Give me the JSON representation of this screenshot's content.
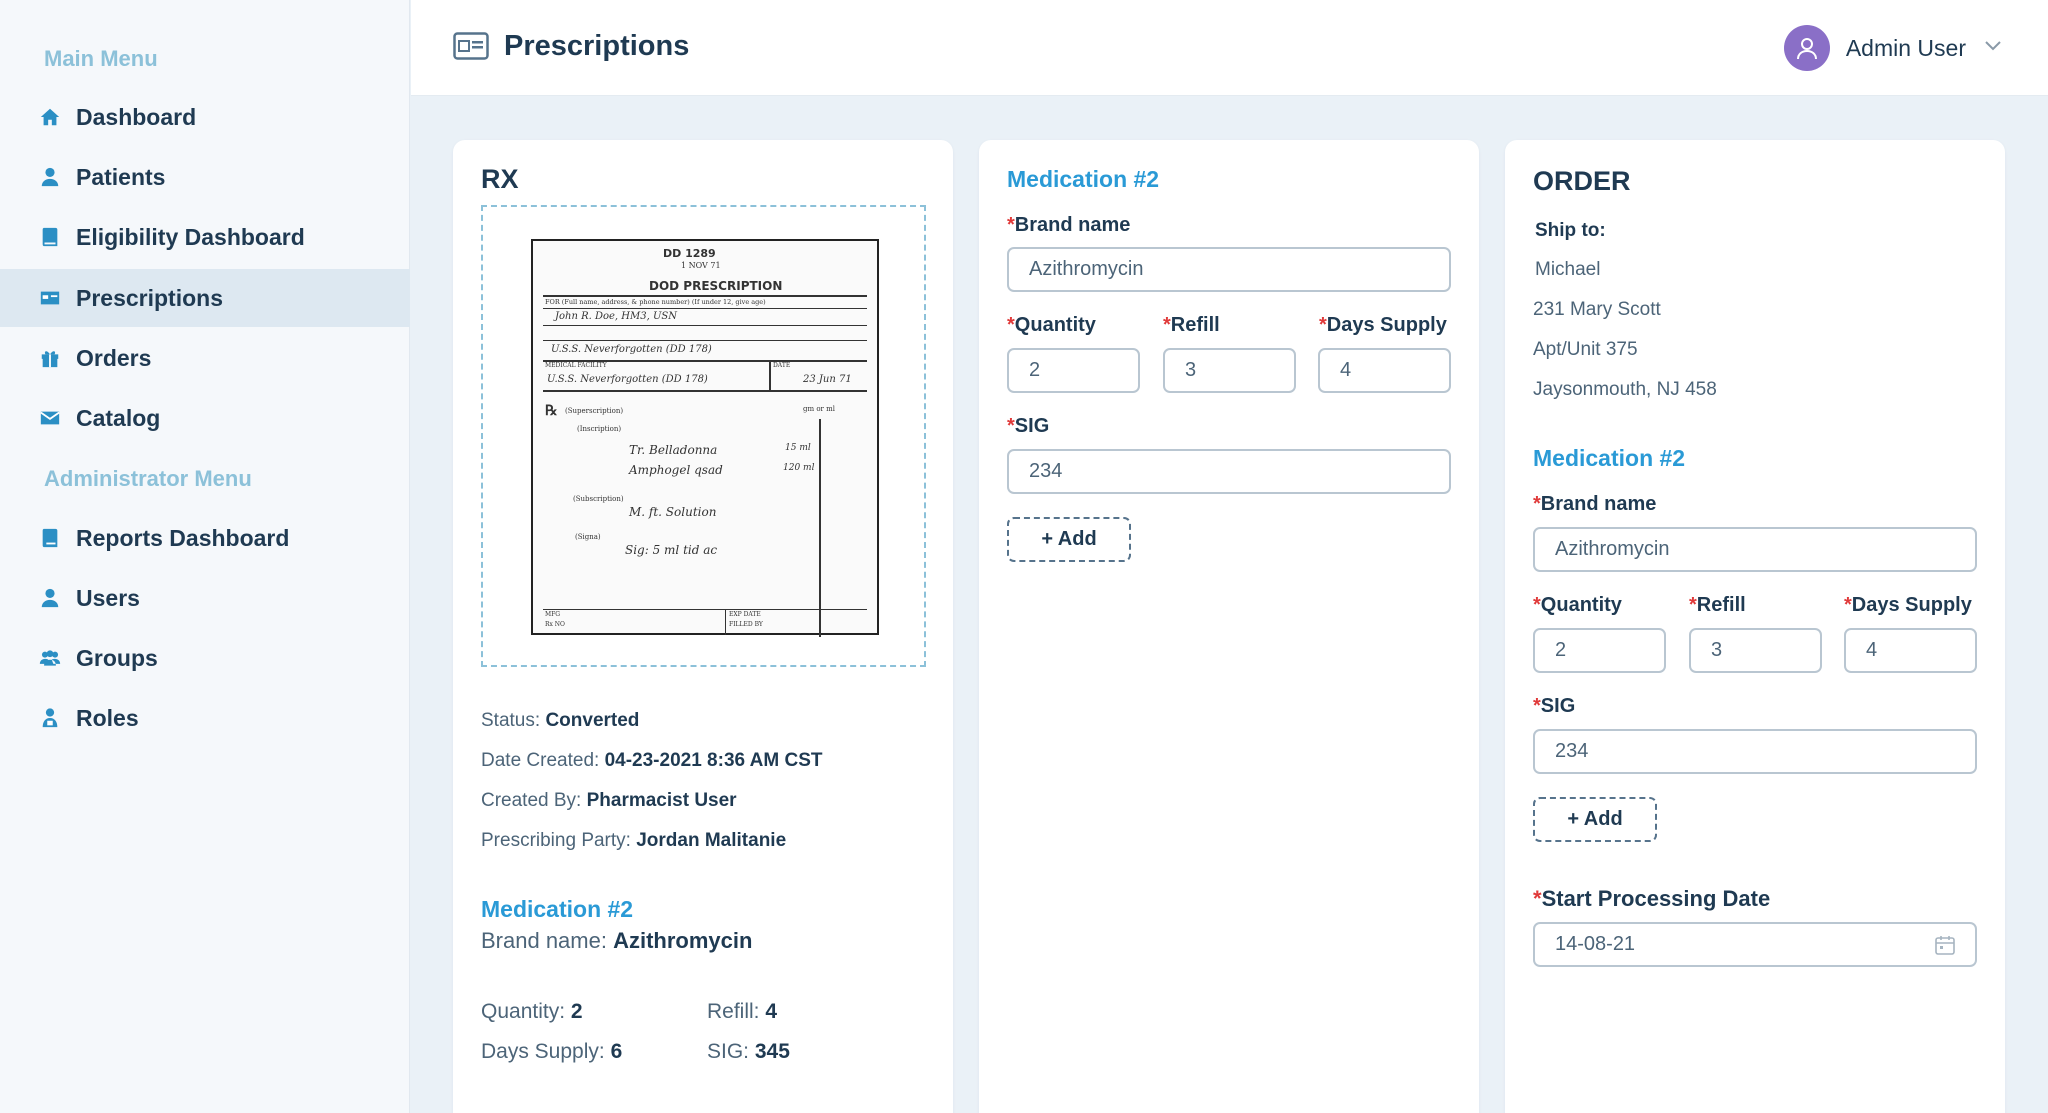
{
  "sidebar": {
    "main_heading": "Main Menu",
    "admin_heading": "Administrator Menu",
    "main_items": [
      {
        "label": "Dashboard",
        "icon": "home-icon"
      },
      {
        "label": "Patients",
        "icon": "person-icon"
      },
      {
        "label": "Eligibility Dashboard",
        "icon": "book-icon"
      },
      {
        "label": "Prescriptions",
        "icon": "card-icon",
        "active": true
      },
      {
        "label": "Orders",
        "icon": "gift-icon"
      },
      {
        "label": "Catalog",
        "icon": "envelope-icon"
      }
    ],
    "admin_items": [
      {
        "label": "Reports Dashboard",
        "icon": "report-icon"
      },
      {
        "label": "Users",
        "icon": "person-icon"
      },
      {
        "label": "Groups",
        "icon": "group-icon"
      },
      {
        "label": "Roles",
        "icon": "role-icon"
      }
    ]
  },
  "header": {
    "title": "Prescriptions",
    "user_name": "Admin User"
  },
  "rx_card": {
    "title": "RX",
    "status_label": "Status:",
    "status_value": "Converted",
    "date_label": "Date Created:",
    "date_value": "04-23-2021 8:36 AM CST",
    "created_by_label": "Created By:",
    "created_by_value": "Pharmacist User",
    "party_label": "Prescribing Party:",
    "party_value": "Jordan Malitanie",
    "medication_title": "Medication #2",
    "brand_label": "Brand name:",
    "brand_value": "Azithromycin",
    "quantity_label": "Quantity:",
    "quantity_value": "2",
    "refill_label": "Refill:",
    "refill_value": "4",
    "days_label": "Days Supply:",
    "days_value": "6",
    "sig_label": "SIG:",
    "sig_value": "345",
    "doc": {
      "form_no": "DD 1289",
      "date_line": "1 NOV 71",
      "heading": "DOD PRESCRIPTION",
      "field_for": "FOR (Full name, address, & phone number) (If under 12, give age)",
      "patient": "John R. Doe, HM3, USN",
      "unit": "U.S.S. Neverforgotten (DD 178)",
      "facility_label": "MEDICAL FACILITY",
      "date_label": "DATE",
      "facility": "U.S.S. Neverforgotten (DD 178)",
      "date": "23 Jun 71",
      "rx_sym": "℞",
      "superscription": "(Superscription)",
      "inscription": "(Inscription)",
      "gm": "gm or ml",
      "drug1": "Tr. Belladonna",
      "drug2": "Amphogel qsad",
      "qty1": "15 ml",
      "qty2": "120 ml",
      "subscription": "(Subscription)",
      "mix": "M. ft. Solution",
      "signa": "(Signa)",
      "sig": "Sig: 5 ml tid ac",
      "mfg": "MFG",
      "rx_no": "Rx NO",
      "exp_date": "EXP DATE",
      "filled_by": "FILLED BY"
    }
  },
  "med_card": {
    "title": "Medication #2",
    "brand_label": "Brand name",
    "brand_value": "Azithromycin",
    "quantity_label": "Quantity",
    "quantity_value": "2",
    "refill_label": "Refill",
    "refill_value": "3",
    "days_label": "Days Supply",
    "days_value": "4",
    "sig_label": "SIG",
    "sig_value": "234",
    "add_label": "+ Add"
  },
  "order_card": {
    "title": "ORDER",
    "ship_label": "Ship to:",
    "ship_name": "Michael",
    "ship_street": "231 Mary Scott",
    "ship_unit": "Apt/Unit 375",
    "ship_city": "Jaysonmouth, NJ 458",
    "medication_title": "Medication #2",
    "brand_label": "Brand name",
    "brand_value": "Azithromycin",
    "quantity_label": "Quantity",
    "quantity_value": "2",
    "refill_label": "Refill",
    "refill_value": "3",
    "days_label": "Days Supply",
    "days_value": "4",
    "sig_label": "SIG",
    "sig_value": "234",
    "add_label": "+ Add",
    "start_label": "Start Processing Date",
    "start_value": "14-08-21"
  },
  "required_mark": "*",
  "colors": {
    "accent": "#2a9ad6",
    "sidebar_heading": "#8cc1d9",
    "text": "#1f3a52",
    "avatar": "#8a6fc7",
    "required": "#e03a3a"
  }
}
